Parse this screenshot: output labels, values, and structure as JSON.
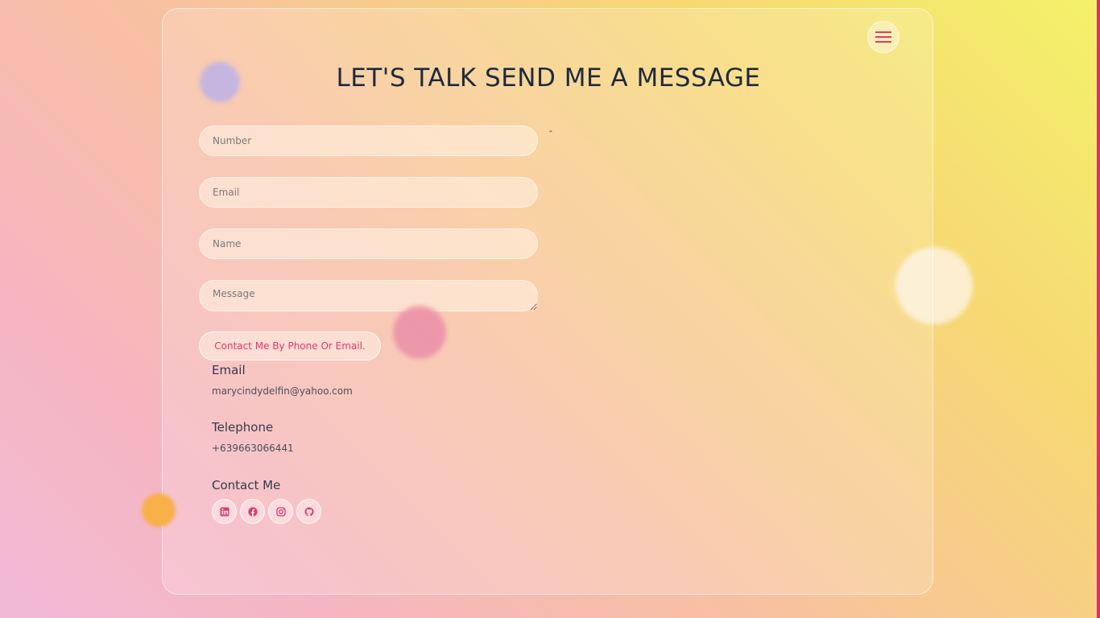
{
  "page": {
    "title": "LET'S TALK SEND ME A MESSAGE",
    "dash": "-"
  },
  "menu": {
    "icon": "hamburger-menu-icon"
  },
  "form": {
    "number_placeholder": "Number",
    "email_placeholder": "Email",
    "name_placeholder": "Name",
    "message_placeholder": "Message",
    "submit_label": "Contact Me By Phone Or Email."
  },
  "info": {
    "email_heading": "Email",
    "email_value": "marycindydelfin@yahoo.com",
    "telephone_heading": "Telephone",
    "telephone_value": "+639663066441",
    "contact_heading": "Contact Me"
  },
  "socials": [
    {
      "icon": "linkedin-icon"
    },
    {
      "icon": "facebook-icon"
    },
    {
      "icon": "instagram-icon"
    },
    {
      "icon": "github-icon"
    }
  ],
  "colors": {
    "accent": "#e03a6d",
    "title_text": "#1f2a3d"
  }
}
